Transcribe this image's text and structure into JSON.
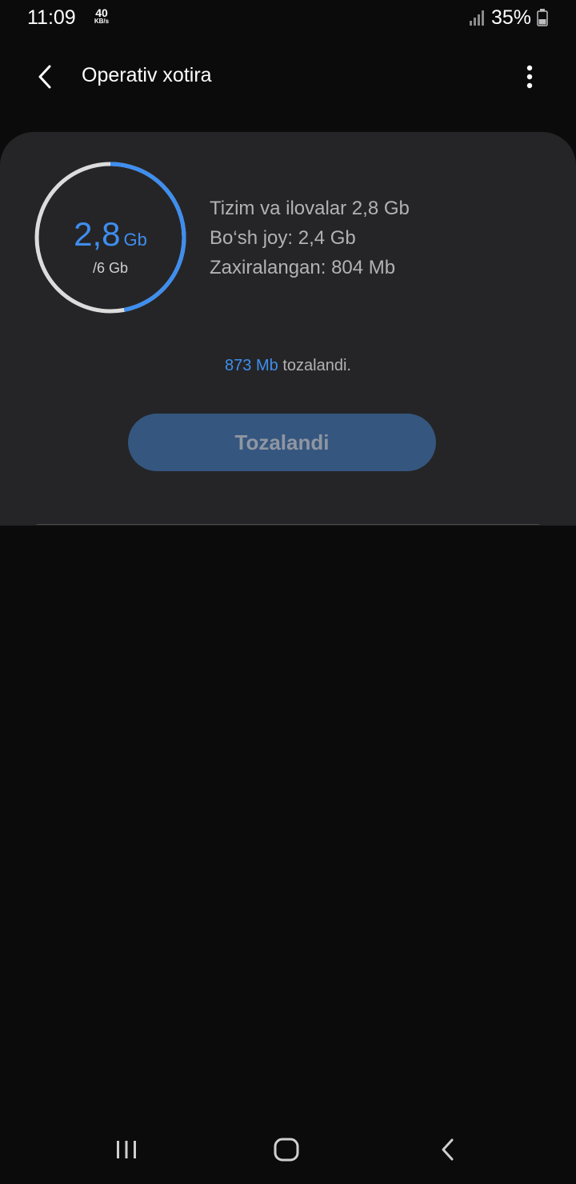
{
  "status_bar": {
    "time": "11:09",
    "net_speed_value": "40",
    "net_speed_unit": "KB/s",
    "battery_percent": "35%"
  },
  "app_bar": {
    "title": "Operativ xotira"
  },
  "memory": {
    "used_value": "2,8",
    "used_unit": "Gb",
    "total": "/6 Gb",
    "used_fraction": 0.47,
    "stats": [
      "Tizim va ilovalar 2,8 Gb",
      "Bo‘sh joy: 2,4 Gb",
      "Zaxiralangan: 804 Mb"
    ]
  },
  "freed": {
    "amount": "873 Mb",
    "suffix": " tozalandi."
  },
  "actions": {
    "clean_button_label": "Tozalandi"
  },
  "navigation": {
    "recents_icon": "recents-icon",
    "home_icon": "home-icon",
    "back_icon": "back-icon"
  },
  "colors": {
    "accent": "#3e8eef",
    "background": "#0b0b0c",
    "card": "#252527",
    "button": "#35567f"
  }
}
